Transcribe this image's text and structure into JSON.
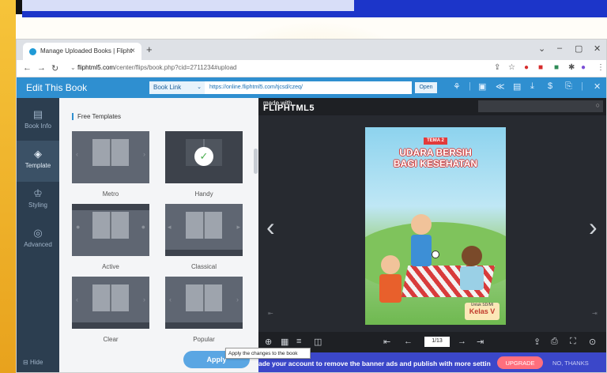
{
  "browser": {
    "tab_title": "Manage Uploaded Books | Flipht",
    "tab_close": "×",
    "new_tab": "+",
    "url_host": "fliphtml5.com",
    "url_path": "/center/flips/book.php?cid=2711234#upload",
    "controls": {
      "minimize": "–",
      "maximize": "▢",
      "close": "✕",
      "dropdown": "⌄"
    }
  },
  "editor": {
    "title": "Edit This Book",
    "link_select": "Book Link",
    "book_url": "https://online.fliphtml5.com/tjcsd/czeq/",
    "open_label": "Open"
  },
  "sidebar": {
    "items": [
      {
        "label": "Book Info",
        "icon": "book-info-icon"
      },
      {
        "label": "Template",
        "icon": "template-icon"
      },
      {
        "label": "Styling",
        "icon": "styling-icon"
      },
      {
        "label": "Advanced",
        "icon": "advanced-icon"
      }
    ],
    "hide_label": "Hide"
  },
  "templates": {
    "heading": "Free Templates",
    "items": [
      {
        "name": "Metro",
        "selected": false
      },
      {
        "name": "Handy",
        "selected": true
      },
      {
        "name": "Active",
        "selected": false
      },
      {
        "name": "Classical",
        "selected": false
      },
      {
        "name": "Clear",
        "selected": false
      },
      {
        "name": "Popular",
        "selected": false
      }
    ]
  },
  "viewer": {
    "logo_small": "made with",
    "logo_big": "FLIPHTML5",
    "page_indicator": "1/13",
    "cover": {
      "tag": "TEMA 2",
      "title_line1": "UDARA BERSIH",
      "title_line2": "BAGI KESEHATAN",
      "grade_small": "Untuk SD/MI",
      "grade_big": "Kelas V"
    }
  },
  "banner": {
    "text": "ade your account to remove the banner ads and publish with more settin",
    "upgrade": "UPGRADE",
    "no_thanks": "NO, THANKS"
  },
  "apply": {
    "label": "Apply",
    "tooltip": "Apply the changes to the book"
  },
  "colors": {
    "slide_top_bar": "#1c35c9",
    "editor_bar": "#2f8fd0",
    "sidebar": "#2c3e50",
    "viewer_bg": "#272a30",
    "banner": "#3b47c9",
    "upgrade": "#ff6f7d"
  }
}
